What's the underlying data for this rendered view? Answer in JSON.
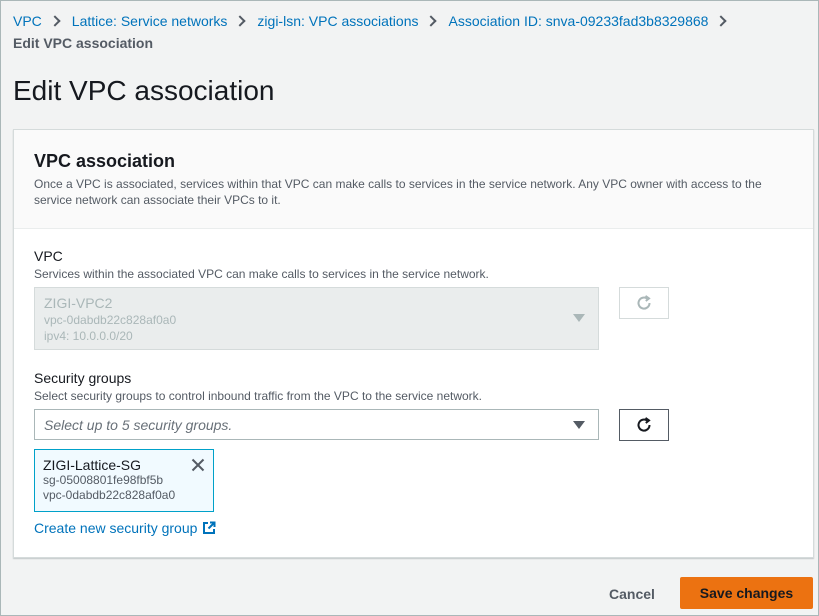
{
  "breadcrumb": {
    "items": [
      "VPC",
      "Lattice: Service networks",
      "zigi-lsn: VPC associations",
      "Association ID: snva-09233fad3b8329868"
    ],
    "current": "Edit VPC association"
  },
  "page_title": "Edit VPC association",
  "panel": {
    "title": "VPC association",
    "description": "Once a VPC is associated, services within that VPC can make calls to services in the service network. Any VPC owner with access to the service network can associate their VPCs to it."
  },
  "vpc_field": {
    "label": "VPC",
    "description": "Services within the associated VPC can make calls to services in the service network.",
    "selected_name": "ZIGI-VPC2",
    "selected_id": "vpc-0dabdb22c828af0a0",
    "selected_cidr": "ipv4: 10.0.0.0/20"
  },
  "sg_field": {
    "label": "Security groups",
    "description": "Select security groups to control inbound traffic from the VPC to the service network.",
    "placeholder": "Select up to 5 security groups.",
    "token": {
      "name": "ZIGI-Lattice-SG",
      "id": "sg-05008801fe98fbf5b",
      "vpc": "vpc-0dabdb22c828af0a0"
    },
    "create_link": "Create new security group"
  },
  "actions": {
    "cancel": "Cancel",
    "save": "Save changes"
  },
  "colors": {
    "link": "#0073bb",
    "primary_button": "#ec7211",
    "token_border": "#00a1c9",
    "token_bg": "#f1faff"
  },
  "icons": [
    "chevron-right-icon",
    "refresh-icon",
    "caret-down-icon",
    "close-icon",
    "external-link-icon"
  ]
}
